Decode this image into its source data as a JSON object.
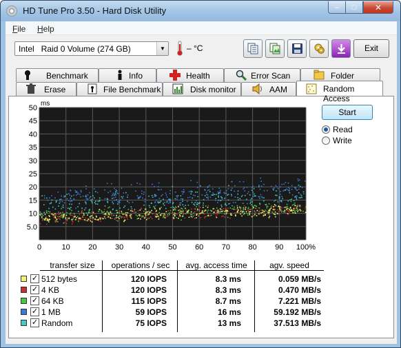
{
  "window": {
    "title": "HD Tune Pro 3.50 - Hard Disk Utility",
    "min": "–",
    "max": "□",
    "close": "✕"
  },
  "menu": {
    "file_pre": "",
    "file_u": "F",
    "file_rest": "ile",
    "help_u": "H",
    "help_rest": "elp"
  },
  "drive": {
    "selected": "Intel   Raid 0 Volume (274 GB)",
    "arrow": "▼"
  },
  "temperature": {
    "value": "– °C"
  },
  "toolbar": {
    "icons": [
      "copy-text-icon",
      "copy-image-icon",
      "save-icon",
      "options-icon",
      "download-icon"
    ],
    "exit_label": "Exit"
  },
  "tabs_back": [
    {
      "label": "Benchmark",
      "icon": "benchmark-icon"
    },
    {
      "label": "Info",
      "icon": "info-icon"
    },
    {
      "label": "Health",
      "icon": "health-icon"
    },
    {
      "label": "Error Scan",
      "icon": "error-scan-icon"
    },
    {
      "label": "Folder Usage",
      "icon": "folder-usage-icon"
    }
  ],
  "tabs_front": [
    {
      "label": "Erase",
      "icon": "erase-icon"
    },
    {
      "label": "File Benchmark",
      "icon": "file-benchmark-icon"
    },
    {
      "label": "Disk monitor",
      "icon": "disk-monitor-icon"
    },
    {
      "label": "AAM",
      "icon": "aam-icon"
    },
    {
      "label": "Random Access",
      "icon": "random-access-icon",
      "active": true
    }
  ],
  "controls": {
    "start_label": "Start",
    "read_label": "Read",
    "write_label": "Write",
    "mode": "Read"
  },
  "chart_data": {
    "type": "scatter",
    "ylabel": "ms",
    "y_ticks": [
      "50",
      "45",
      "40",
      "35",
      "30",
      "25",
      "20",
      "15",
      "10",
      "5.0"
    ],
    "x_ticks": [
      "0",
      "10",
      "20",
      "30",
      "40",
      "50",
      "60",
      "70",
      "80",
      "90",
      "100%"
    ],
    "xlim": [
      0,
      100
    ],
    "ylim": [
      0,
      50
    ],
    "grid": true,
    "background": "#1a1a1a",
    "series": [
      {
        "name": "512 bytes",
        "color": "#f4f46a",
        "y_center": 8.3,
        "spread": 3.5
      },
      {
        "name": "4 KB",
        "color": "#c83030",
        "y_center": 8.3,
        "spread": 3.5
      },
      {
        "name": "64 KB",
        "color": "#46c846",
        "y_center": 8.7,
        "spread": 4.0
      },
      {
        "name": "1 MB",
        "color": "#3c78d8",
        "y_center": 16,
        "spread": 6.0
      },
      {
        "name": "Random",
        "color": "#46c8c8",
        "y_center": 13,
        "spread": 7.0
      }
    ]
  },
  "results": {
    "headers": {
      "transfer": "transfer size",
      "ops": "operations / sec",
      "access": "avg. access time",
      "speed": "agv. speed"
    },
    "rows": [
      {
        "name": "512 bytes",
        "color": "#f4f46a",
        "checked": "✓",
        "ops": "120 IOPS",
        "access": "8.3 ms",
        "speed": "0.059 MB/s"
      },
      {
        "name": "4 KB",
        "color": "#c83030",
        "checked": "✓",
        "ops": "120 IOPS",
        "access": "8.3 ms",
        "speed": "0.470 MB/s"
      },
      {
        "name": "64 KB",
        "color": "#46c846",
        "checked": "✓",
        "ops": "115 IOPS",
        "access": "8.7 ms",
        "speed": "7.221 MB/s"
      },
      {
        "name": "1 MB",
        "color": "#3c78d8",
        "checked": "✓",
        "ops": "59 IOPS",
        "access": "16 ms",
        "speed": "59.192 MB/s"
      },
      {
        "name": "Random",
        "color": "#46c8c8",
        "checked": "✓",
        "ops": "75 IOPS",
        "access": "13 ms",
        "speed": "37.513 MB/s"
      }
    ]
  }
}
